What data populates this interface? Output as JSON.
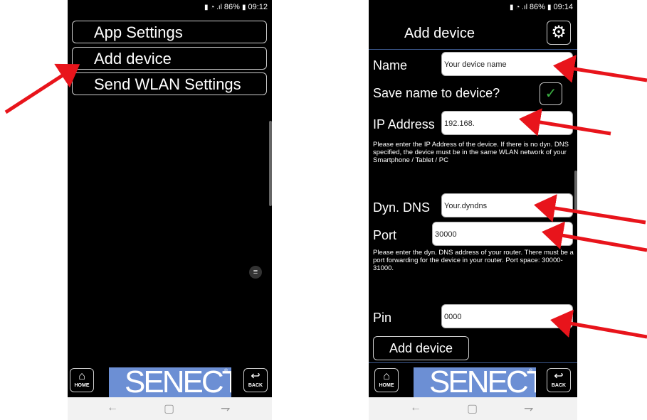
{
  "left": {
    "status": {
      "battery": "86%",
      "time": "09:12"
    },
    "menu": [
      "App Settings",
      "Add device",
      "Send WLAN Settings"
    ],
    "home_label": "HOME",
    "back_label": "BACK",
    "logo_text": "SENECT"
  },
  "right": {
    "status": {
      "battery": "86%",
      "time": "09:14"
    },
    "title": "Add device",
    "name_label": "Name",
    "name_value": "Your device name",
    "save_name_label": "Save name to device?",
    "save_name_checked": true,
    "ip_label": "IP Address",
    "ip_value": "192.168.",
    "ip_help": "Please enter the IP Address of the device. If there is no dyn. DNS specified, the device must be in the same WLAN network of your Smartphone / Tablet / PC",
    "dns_label": "Dyn. DNS",
    "dns_value": "Your.dyndns",
    "port_label": "Port",
    "port_value": "30000",
    "dns_help": "Please enter the dyn. DNS address of your router. There must be a port forwarding for the device in your router. Port space: 30000-31000.",
    "pin_label": "Pin",
    "pin_value": "0000",
    "add_button": "Add device",
    "home_label": "HOME",
    "back_label": "BACK",
    "logo_text": "SENECT"
  },
  "colors": {
    "annotation_arrow": "#e8141b",
    "logo_bg": "#6c8fd4",
    "check": "#3cb043",
    "divider": "#3d5a8f"
  }
}
